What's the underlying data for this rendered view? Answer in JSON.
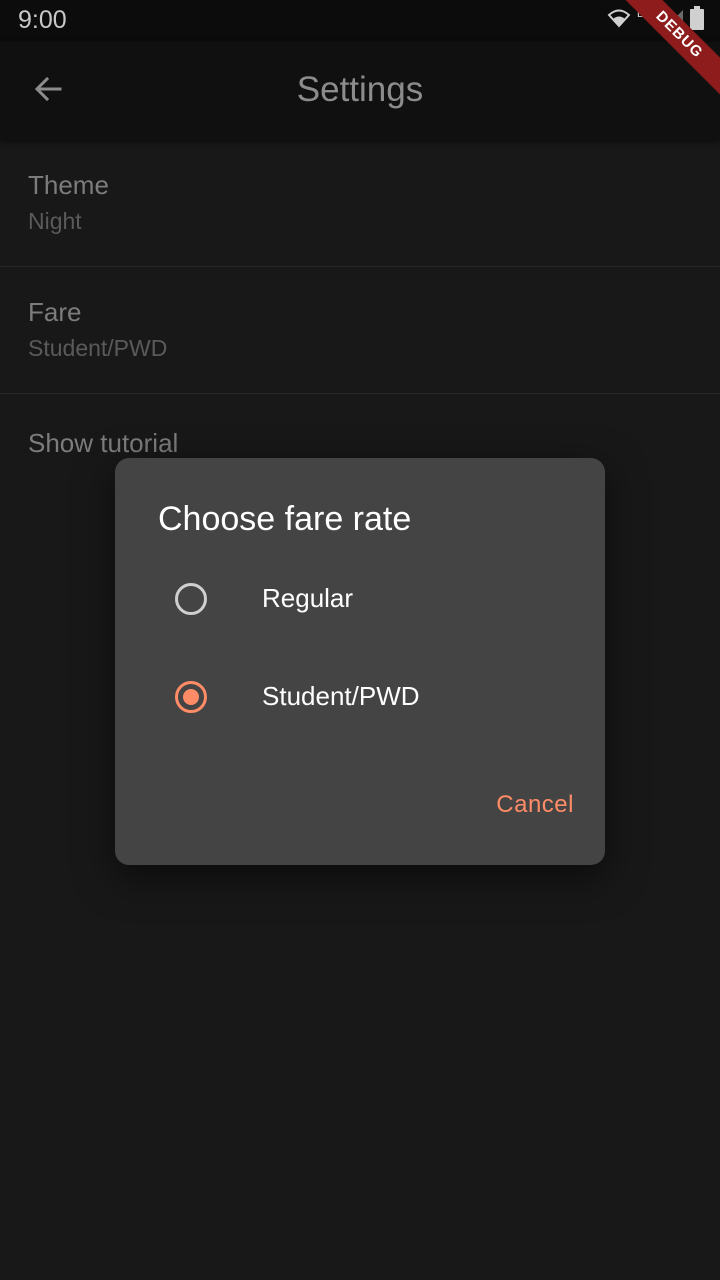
{
  "status_bar": {
    "time": "9:00",
    "network": "LTE",
    "icons": [
      "wifi-icon",
      "cell-signal-icon",
      "battery-icon"
    ]
  },
  "debug_banner": "DEBUG",
  "app_bar": {
    "title": "Settings",
    "back_icon": "arrow-back-icon"
  },
  "settings": {
    "items": [
      {
        "title": "Theme",
        "value": "Night"
      },
      {
        "title": "Fare",
        "value": "Student/PWD"
      },
      {
        "title": "Show tutorial"
      }
    ]
  },
  "dialog": {
    "title": "Choose fare rate",
    "options": [
      {
        "label": "Regular",
        "selected": false
      },
      {
        "label": "Student/PWD",
        "selected": true
      }
    ],
    "cancel_label": "Cancel"
  },
  "colors": {
    "accent": "#ff8c66",
    "background": "#181818",
    "dialog": "#444444",
    "debug_banner": "#8f1c1c"
  }
}
